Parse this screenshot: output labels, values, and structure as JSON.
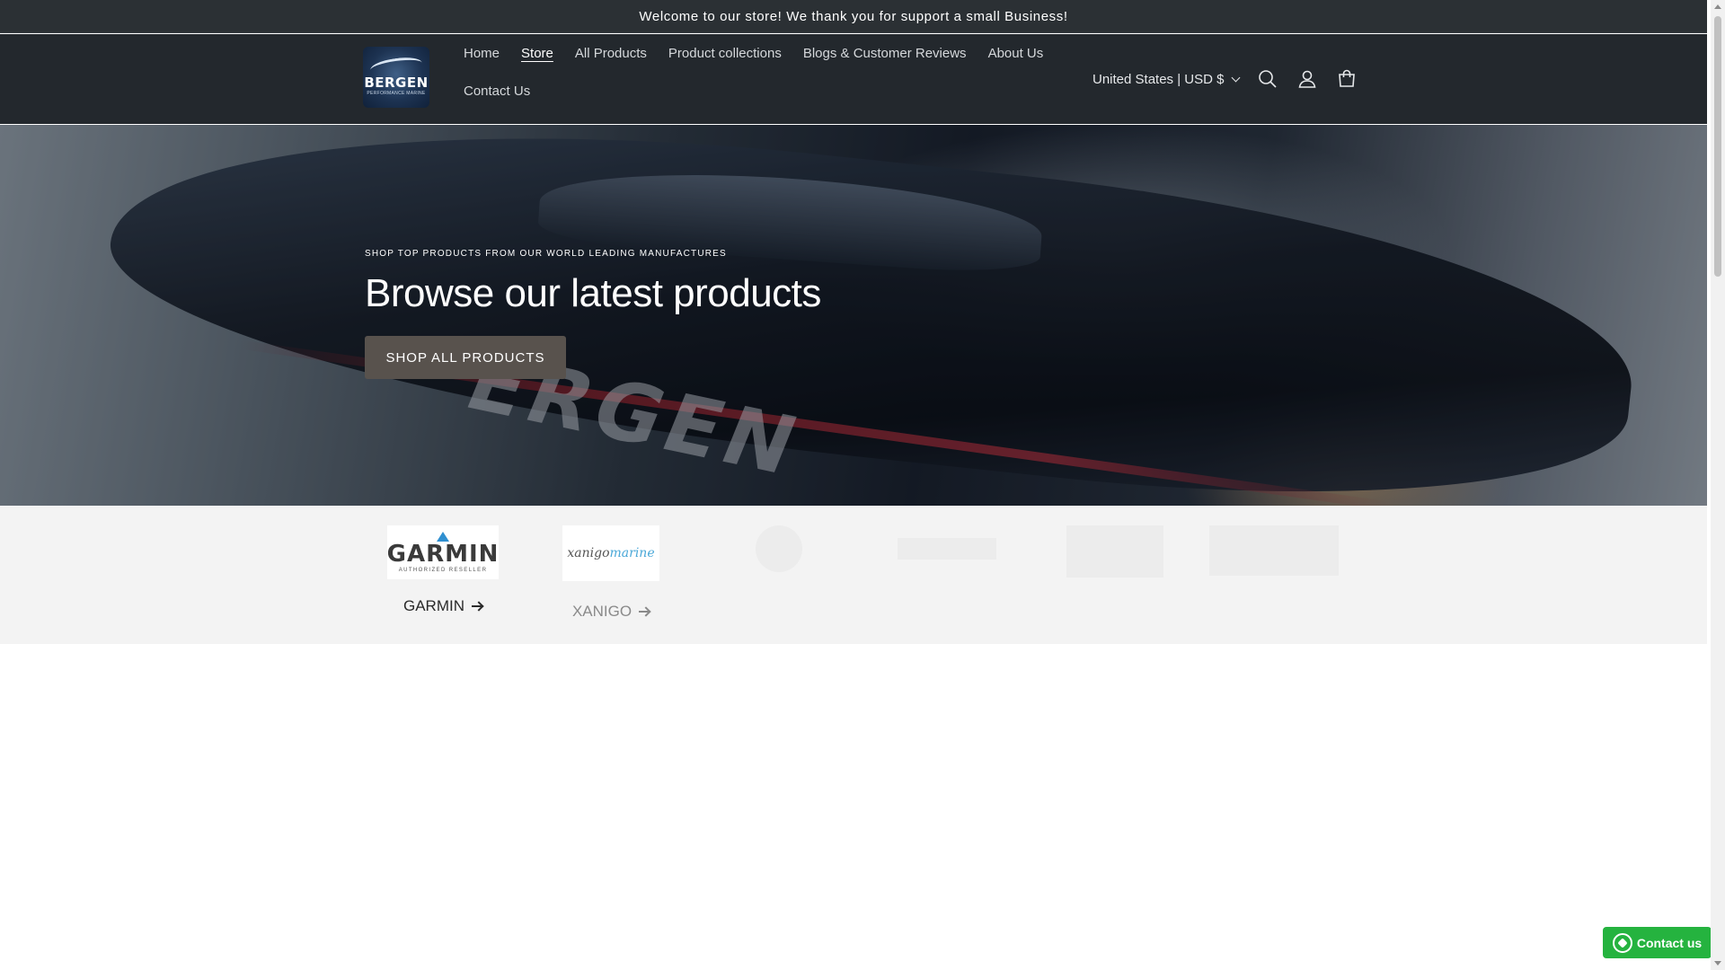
{
  "announcement": {
    "text": "Welcome to our store! We thank you for support a small Business!"
  },
  "header": {
    "logo": {
      "brand": "BERGEN",
      "tagline": "PERFORMANCE MARINE",
      "icon": "bergen-logo"
    },
    "nav": [
      {
        "label": "Home",
        "active": false
      },
      {
        "label": "Store",
        "active": true
      },
      {
        "label": "All Products",
        "active": false
      },
      {
        "label": "Product collections",
        "active": false
      },
      {
        "label": "Blogs & Customer Reviews",
        "active": false
      },
      {
        "label": "About Us",
        "active": false
      },
      {
        "label": "Contact Us",
        "active": false
      }
    ],
    "currency": "United States | USD $",
    "icons": [
      "search-icon",
      "account-icon",
      "cart-icon"
    ]
  },
  "hero": {
    "kicker": "SHOP TOP PRODUCTS FROM OUR WORLD LEADING MANUFACTURES",
    "title": "Browse our latest products",
    "button": "SHOP ALL PRODUCTS",
    "boat_text": "ERGEN"
  },
  "brands": [
    {
      "name": "GARMIN",
      "logo_title": "GARMIN",
      "logo_sub": "AUTHORIZED RESELLER"
    },
    {
      "name": "XANIGO",
      "logo_title": "xanigo",
      "logo_sub": "marine"
    }
  ],
  "whatsapp": {
    "label": "Contact us"
  },
  "colors": {
    "header_bg": "#23282d",
    "announce_bg": "#2b3034",
    "button_bg": "#58524d",
    "whatsapp": "#25b33f",
    "brands_bg": "#f3f3f3"
  }
}
